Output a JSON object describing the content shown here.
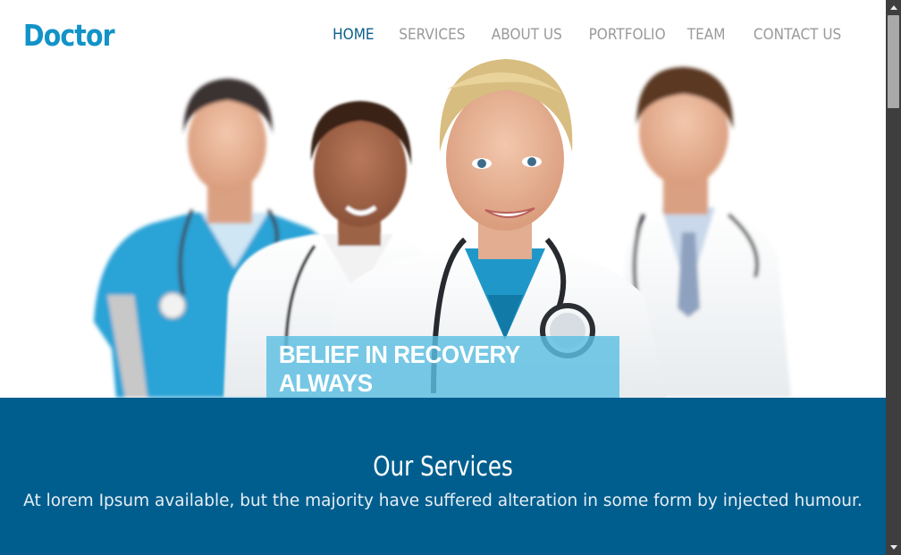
{
  "header": {
    "logo": "Doctor",
    "nav": [
      {
        "label": "HOME",
        "active": true
      },
      {
        "label": "SERVICES",
        "active": false
      },
      {
        "label": "ABOUT US",
        "active": false
      },
      {
        "label": "PORTFOLIO",
        "active": false
      },
      {
        "label": "TEAM",
        "active": false
      },
      {
        "label": "CONTACT US",
        "active": false
      }
    ]
  },
  "hero": {
    "image": "doctors-team-photo",
    "tagline": "BELIEF IN RECOVERY ALWAYS"
  },
  "services": {
    "title": "Our Services",
    "subtitle": "At lorem Ipsum available, but the majority have suffered alteration in some form by injected humour."
  },
  "colors": {
    "brand": "#1193c8",
    "nav_active": "#0b5d8a",
    "nav": "#9a9a9a",
    "services_bg": "#005e8e",
    "tagline_bg": "#5bbee2"
  }
}
